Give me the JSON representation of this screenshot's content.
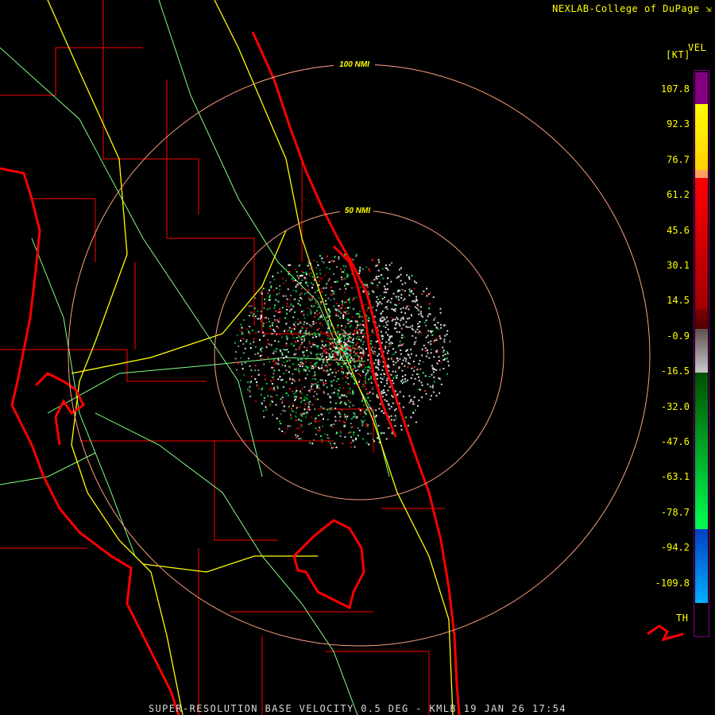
{
  "header": {
    "credit": "NEXLAB-College of DuPage",
    "credit_icon": "nexlab-logo-icon"
  },
  "legend": {
    "product": "VEL",
    "unit": "[KT]",
    "ticks": [
      "107.8",
      "92.3",
      "76.7",
      "61.2",
      "45.6",
      "30.1",
      "14.5",
      "-0.9",
      "-16.5",
      "-32.0",
      "-47.6",
      "-63.1",
      "-78.7",
      "-94.2",
      "-109.8"
    ],
    "th_label": "TH",
    "colors": {
      "purple": "#800080",
      "yellow": "#ffff00",
      "orange": "#ffa060",
      "red": "#ff0000",
      "darkred": "#700000",
      "gray": "#c8c8c8",
      "green": "#00ff50",
      "darkgreen": "#005000",
      "blue": "#0040c0",
      "lightblue": "#00b0ff"
    }
  },
  "map": {
    "ring_labels": [
      "100 NMI",
      "50 NMI"
    ],
    "colors": {
      "county": "#ff0000",
      "highway": "#ffff00",
      "road": "#80ff80",
      "coast": "#ff0000",
      "ring": "#ffa080"
    }
  },
  "footer": {
    "caption": "SUPER-RESOLUTION BASE VELOCITY 0.5 DEG - KMLB 19 JAN 26 17:54"
  }
}
